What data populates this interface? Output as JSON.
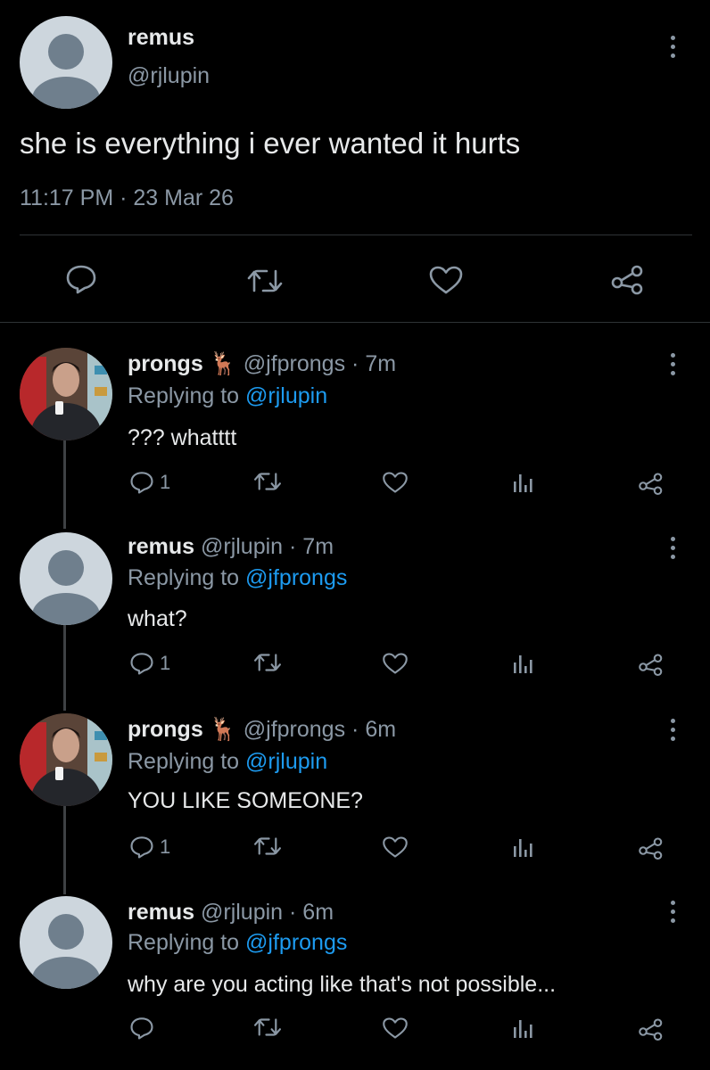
{
  "main_tweet": {
    "name": "remus",
    "handle": "@rjlupin",
    "text": "she is everything i ever wanted it hurts",
    "timestamp": "11:17 PM · 23 Mar 26"
  },
  "replies": [
    {
      "name": "prongs",
      "emoji": "🦌",
      "handle": "@jfprongs",
      "time": "· 7m",
      "replying_prefix": "Replying to",
      "replying_to": "@rjlupin",
      "text": "??? whatttt",
      "reply_count": "1"
    },
    {
      "name": "remus",
      "emoji": "",
      "handle": "@rjlupin",
      "time": "· 7m",
      "replying_prefix": "Replying to",
      "replying_to": "@jfprongs",
      "text": "what?",
      "reply_count": "1"
    },
    {
      "name": "prongs",
      "emoji": "🦌",
      "handle": "@jfprongs",
      "time": "· 6m",
      "replying_prefix": "Replying to",
      "replying_to": "@rjlupin",
      "text": "YOU LIKE SOMEONE?",
      "reply_count": "1"
    },
    {
      "name": "remus",
      "emoji": "",
      "handle": "@rjlupin",
      "time": "· 6m",
      "replying_prefix": "Replying to",
      "replying_to": "@jfprongs",
      "text": "why are you acting like that's not possible...",
      "reply_count": ""
    }
  ],
  "icons": [
    "reply-icon",
    "retweet-icon",
    "like-icon",
    "analytics-icon",
    "share-icon",
    "more-icon"
  ],
  "colors": {
    "background": "#000000",
    "text": "#e7e9ea",
    "muted": "#8b98a5",
    "link": "#1d9bf0"
  }
}
